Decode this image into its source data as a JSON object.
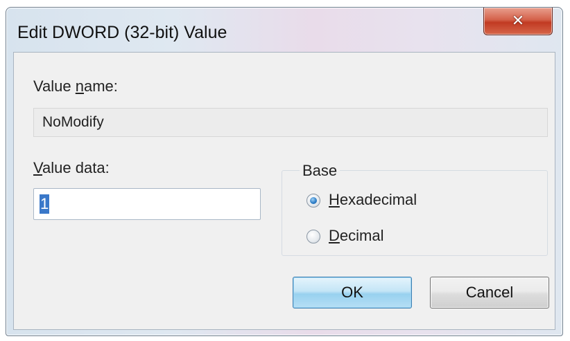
{
  "window": {
    "title": "Edit DWORD (32-bit) Value",
    "close_label": "✕"
  },
  "value_name": {
    "label_prefix": "Value ",
    "label_underlined": "n",
    "label_suffix": "ame:",
    "value": "NoModify"
  },
  "value_data": {
    "label_underlined": "V",
    "label_suffix": "alue data:",
    "value": "1"
  },
  "base": {
    "legend": "Base",
    "options": [
      {
        "underlined": "H",
        "rest": "exadecimal",
        "checked": true
      },
      {
        "underlined": "D",
        "rest": "ecimal",
        "checked": false
      }
    ]
  },
  "buttons": {
    "ok_label": "OK",
    "cancel_label": "Cancel"
  }
}
